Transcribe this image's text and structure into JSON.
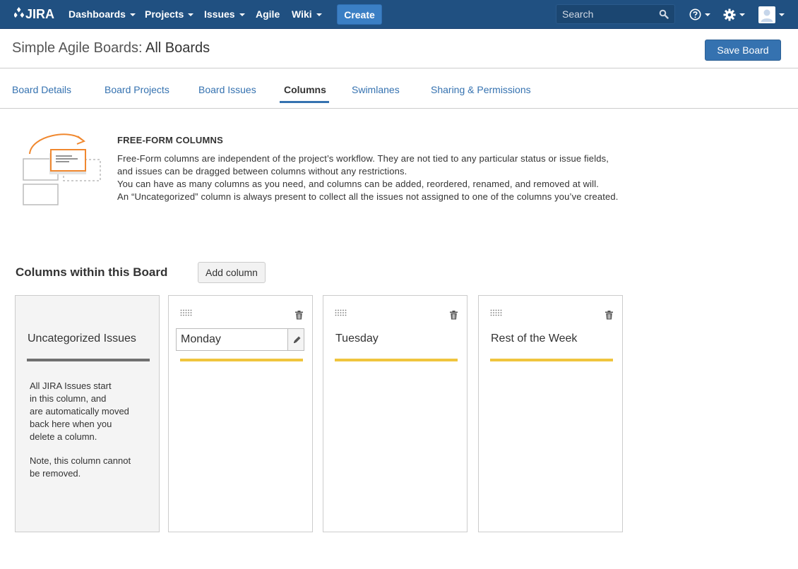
{
  "colors": {
    "nav_bg": "#205081",
    "accent": "#3572b0",
    "column_rule": "#f0c53e",
    "uncategorized_rule": "#707070",
    "illustration_orange": "#f0882f"
  },
  "header": {
    "logo_text": "JIRA",
    "nav": [
      {
        "label": "Dashboards",
        "dropdown": true
      },
      {
        "label": "Projects",
        "dropdown": true
      },
      {
        "label": "Issues",
        "dropdown": true
      },
      {
        "label": "Agile",
        "dropdown": false
      },
      {
        "label": "Wiki",
        "dropdown": true
      }
    ],
    "create_label": "Create",
    "search_placeholder": "Search",
    "icons": [
      "help-icon",
      "gear-icon",
      "user-avatar-icon"
    ]
  },
  "page": {
    "title_prefix": "Simple Agile Boards:",
    "title_main": "All Boards",
    "save_label": "Save Board"
  },
  "tabs": [
    {
      "label": "Board Details",
      "active": false
    },
    {
      "label": "Board Projects",
      "active": false
    },
    {
      "label": "Board Issues",
      "active": false
    },
    {
      "label": "Columns",
      "active": true
    },
    {
      "label": "Swimlanes",
      "active": false
    },
    {
      "label": "Sharing & Permissions",
      "active": false
    }
  ],
  "intro": {
    "heading": "FREE-FORM COLUMNS",
    "lines": [
      "Free-Form columns are independent of the project’s workflow. They are not tied to any particular status or issue fields,",
      "and issues can be dragged between columns without any restrictions.",
      "You can have as many columns as you need, and columns can be added, reordered, renamed, and removed at will.",
      "An “Uncategorized” column is always present to collect all the issues not assigned to one of the columns you’ve created."
    ]
  },
  "columns_section": {
    "title": "Columns within this Board",
    "add_label": "Add column",
    "uncategorized": {
      "name": "Uncategorized Issues",
      "desc_lines": [
        "All JIRA Issues start",
        "in this column, and",
        "are automatically moved",
        "back here when you",
        "delete a column."
      ],
      "note_lines": [
        "Note, this column cannot",
        "be removed."
      ]
    },
    "columns": [
      {
        "name": "Monday",
        "editing": true
      },
      {
        "name": "Tuesday",
        "editing": false
      },
      {
        "name": "Rest of the Week",
        "editing": false
      }
    ]
  }
}
